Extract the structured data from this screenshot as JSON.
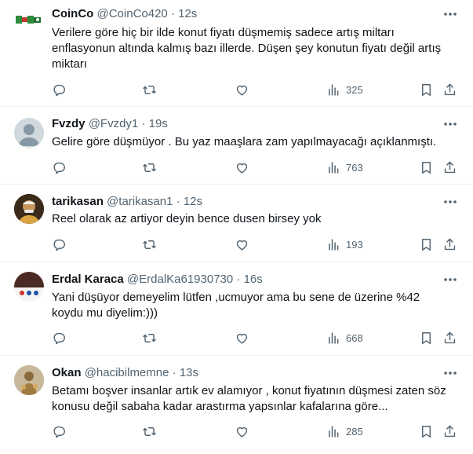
{
  "tweets": [
    {
      "name": "CoinCo",
      "handle": "@CoinCo420",
      "separator": "·",
      "time": "12s",
      "text": "Verilere göre hiç bir ilde konut fiyatı düşmemiş sadece artış miltarı enflasyonun altında kalmış bazı illerde. Düşen şey konutun fiyatı değil artış miktarı",
      "views": "325",
      "avatar": "logo"
    },
    {
      "name": "Fvzdy",
      "handle": "@Fvzdy1",
      "separator": "·",
      "time": "19s",
      "text": "Gelire göre düşmüyor . Bu yaz maaşlara zam yapılmayacağı açıklanmıştı.",
      "views": "763",
      "avatar": "default"
    },
    {
      "name": "tarikasan",
      "handle": "@tarikasan1",
      "separator": "·",
      "time": "12s",
      "text": "Reel olarak az artiyor deyin bence dusen birsey yok",
      "views": "193",
      "avatar": "photo"
    },
    {
      "name": "Erdal Karaca",
      "handle": "@ErdalKa61930730",
      "separator": "·",
      "time": "16s",
      "text": "Yani düşüyor demeyelim lütfen ,ucmuyor ama  bu sene de üzerine %42 koydu mu diyelim:)))",
      "views": "668",
      "avatar": "photo"
    },
    {
      "name": "Okan",
      "handle": "@hacibilmemne",
      "separator": "·",
      "time": "13s",
      "text": "Betamı boşver insanlar artık ev alamıyor , konut fiyatının düşmesi zaten söz konusu değil sabaha kadar arastırma yapsınlar kafalarına göre...",
      "views": "285",
      "avatar": "photo"
    }
  ],
  "icons": {
    "reply": "reply-icon",
    "retweet": "retweet-icon",
    "like": "heart-icon",
    "views": "views-chart-icon",
    "bookmark": "bookmark-icon",
    "share": "share-icon",
    "more": "more-icon"
  },
  "colors": {
    "text": "#0f1419",
    "secondary": "#536471",
    "divider": "#eff3f4"
  }
}
